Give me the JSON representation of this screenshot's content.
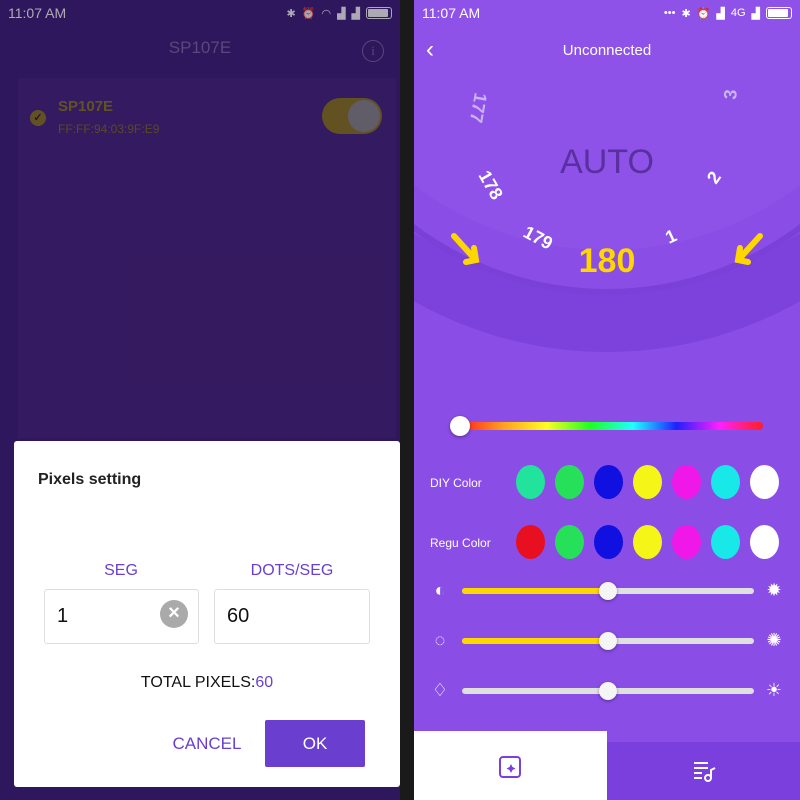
{
  "left": {
    "status": {
      "time": "11:07 AM"
    },
    "title": "SP107E",
    "info_icon": "info-icon",
    "device": {
      "name": "SP107E",
      "mac": "FF:FF:94:03:9F:E9",
      "enabled": true
    },
    "dialog": {
      "title": "Pixels setting",
      "seg_label": "SEG",
      "dots_label": "DOTS/SEG",
      "seg_value": "1",
      "dots_value": "60",
      "total_label": "TOTAL PIXELS:",
      "total_value": "60",
      "cancel": "CANCEL",
      "ok": "OK"
    }
  },
  "right": {
    "status": {
      "time": "11:07 AM",
      "network": "4G"
    },
    "title": "Unconnected",
    "dial": {
      "mode": "AUTO",
      "selected": "180",
      "numbers": [
        "177",
        "178",
        "179",
        "1",
        "2",
        "3"
      ]
    },
    "hue_position": 0,
    "diy_label": "DIY Color",
    "regu_label": "Regu Color",
    "diy_colors": [
      "#22e39b",
      "#27e05a",
      "#1010e0",
      "#f5f518",
      "#f018e8",
      "#18e8e8",
      "#ffffff"
    ],
    "regu_colors": [
      "#e81020",
      "#27e05a",
      "#1010e0",
      "#f5f518",
      "#f018e8",
      "#18e8e8",
      "#ffffff"
    ],
    "sliders": [
      {
        "name": "brightness",
        "value": 0.5,
        "active": true
      },
      {
        "name": "speed",
        "value": 0.5,
        "active": true
      },
      {
        "name": "white",
        "value": 0.5,
        "active": false
      }
    ],
    "colors": {
      "accent": "#8a4de6",
      "highlight": "#ffd700"
    }
  }
}
